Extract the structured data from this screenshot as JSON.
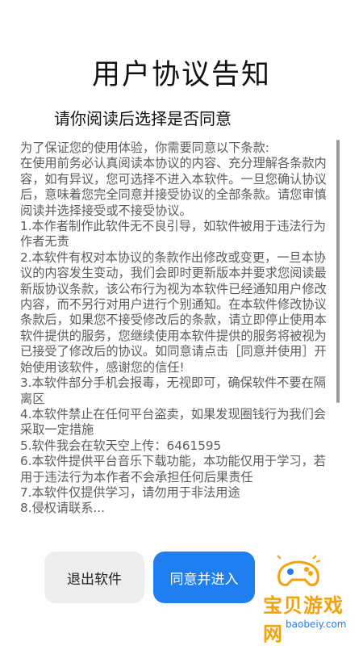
{
  "header": {
    "title": "用户协议告知",
    "subtitle": "请你阅读后选择是否同意"
  },
  "terms": {
    "text": "为了保证您的使用体验，你需要同意以下条款:\n在使用前务必认真阅读本协议的内容、充分理解各条款内容，如有异议，您可选择不进入本软件。一旦您确认协议后，意味着您完全同意并接受协议的全部条款。请您审慎阅读并选择接受或不接受协议。\n1.本作者制作此软件无不良引导，如软件被用于违法行为作者无责\n2.本软件有权对本协议的条款作出修改或变更，一旦本协议的内容发生变动，我们会即时更新版本并要求您阅读最新版协议条款，该公布行为视为本软件已经通知用户修改内容，而不另行对用户进行个别通知。在本软件修改协议条款后，如果您不接受修改后的条款，请立即停止使用本软件提供的服务，您继续使用本软件提供的服务将被视为已接受了修改后的协议。如同意请点击［同意并使用］开始使用该软件，感谢您的信任!\n3.本软件部分手机会报毒，无视即可，确保软件不要在隔离区\n4.本软件禁止在任何平台盗卖，如果发现圈钱行为我们会采取一定措施\n5.软件我会在软天空上传：6461595\n6.本软件提供平台音乐下载功能，本功能仅用于学习，若用于违法行为本作者不会承担任何后果责任\n7.本软件仅提供学习，请勿用于非法用途\n8.侵权请联系..."
  },
  "buttons": {
    "exit_label": "退出软件",
    "agree_label": "同意并进入"
  },
  "watermark": {
    "main": "宝贝游戏网",
    "sub": "baobeiy.com"
  },
  "colors": {
    "primary": "#1f7ff0",
    "secondary_bg": "#ededed",
    "watermark": "#f5a20a"
  }
}
